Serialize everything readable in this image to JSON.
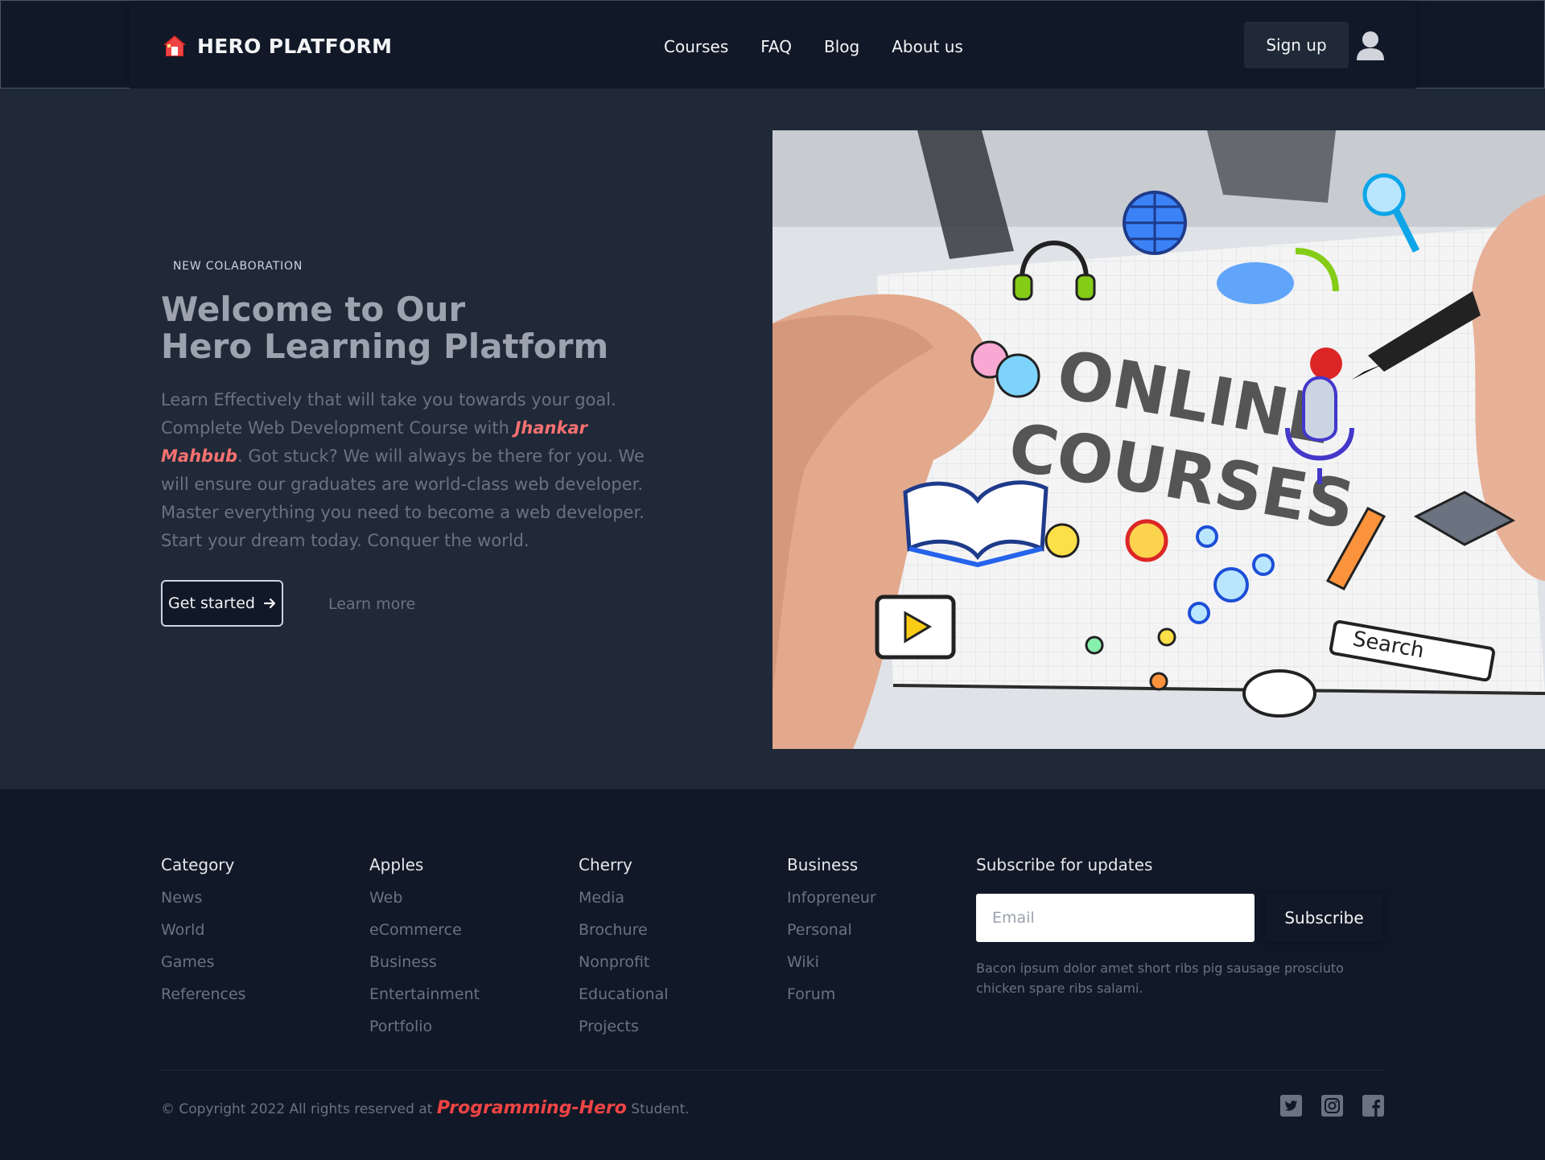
{
  "header": {
    "brand": "HERO PLATFORM",
    "brand_icon": "home-icon",
    "nav": [
      "Courses",
      "FAQ",
      "Blog",
      "About us"
    ],
    "signup_label": "Sign up",
    "avatar_icon": "user-icon"
  },
  "hero": {
    "eyebrow": "NEW COLABORATION",
    "title_line1": "Welcome to Our",
    "title_line2": "Hero Learning Platform",
    "lead_before": "Learn Effectively that will take you towards your goal. Complete Web Development Course with ",
    "lead_author": "Jhankar Mahbub",
    "lead_after": ". Got stuck? We will always be there for you. We will ensure our graduates are world-class web developer. Master everything you need to become a web developer. Start your dream today. Conquer the world.",
    "primary_button": "Get started",
    "secondary_button": "Learn more",
    "image_text_1": "ONLINE",
    "image_text_2": "COURSES",
    "image_search": "Search"
  },
  "footer": {
    "columns": [
      {
        "title": "Category",
        "links": [
          "News",
          "World",
          "Games",
          "References"
        ]
      },
      {
        "title": "Apples",
        "links": [
          "Web",
          "eCommerce",
          "Business",
          "Entertainment",
          "Portfolio"
        ]
      },
      {
        "title": "Cherry",
        "links": [
          "Media",
          "Brochure",
          "Nonprofit",
          "Educational",
          "Projects"
        ]
      },
      {
        "title": "Business",
        "links": [
          "Infopreneur",
          "Personal",
          "Wiki",
          "Forum"
        ]
      }
    ],
    "subscribe_title": "Subscribe for updates",
    "email_placeholder": "Email",
    "subscribe_button": "Subscribe",
    "note": "Bacon ipsum dolor amet short ribs pig sausage prosciuto chicken spare ribs salami.",
    "copyright_before": "© Copyright 2022 All rights reserved at ",
    "copyright_brand": "Programming-Hero",
    "copyright_after": " Student.",
    "social_icons": [
      "twitter-icon",
      "instagram-icon",
      "facebook-icon"
    ]
  },
  "colors": {
    "accent": "#ef4444",
    "author": "#f87171",
    "header_bg": "#111827",
    "hero_bg": "#1f2937"
  }
}
